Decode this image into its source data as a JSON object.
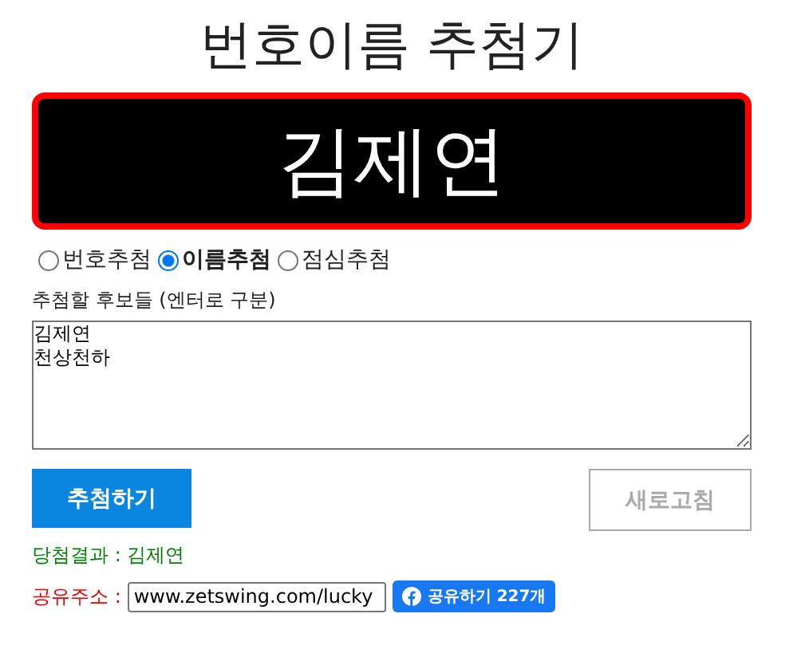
{
  "title": "번호이름 추첨기",
  "display": {
    "value": "김제연"
  },
  "modes": [
    {
      "label": "번호추첨",
      "selected": false
    },
    {
      "label": "이름추첨",
      "selected": true
    },
    {
      "label": "점심추첨",
      "selected": false
    }
  ],
  "candidates": {
    "label": "추첨할 후보들 (엔터로 구분)",
    "value": "김제연\n천상천하"
  },
  "buttons": {
    "draw": "추첨하기",
    "refresh": "새로고침"
  },
  "result": "당첨결과 : 김제연",
  "share": {
    "label": "공유주소 :",
    "url": "www.zetswing.com/lucky",
    "button": "공유하기 227개"
  }
}
